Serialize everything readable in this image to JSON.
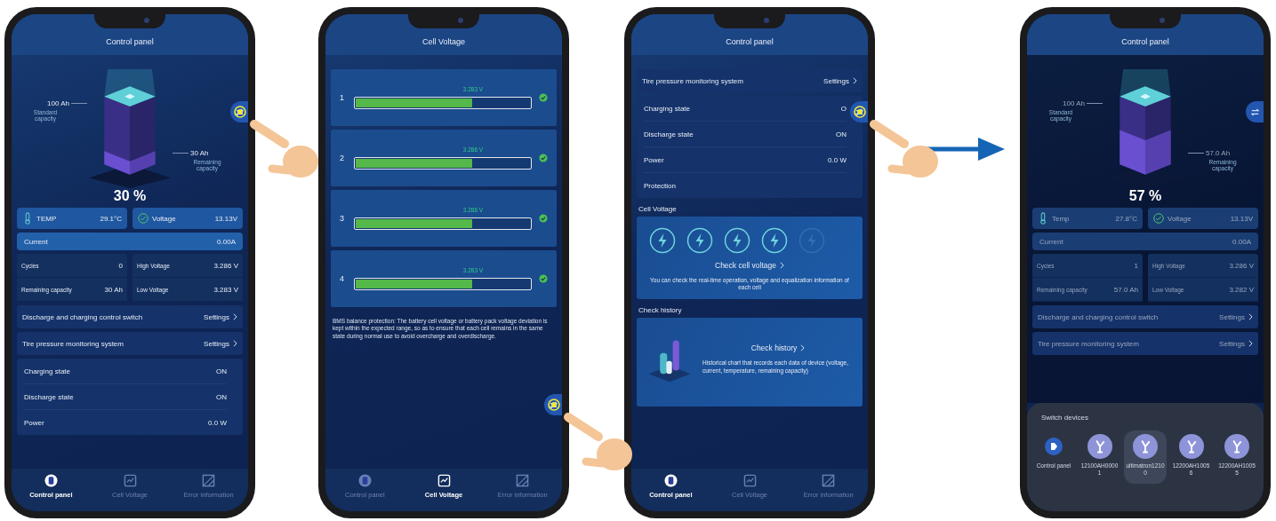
{
  "phones": [
    {
      "title": "Control panel",
      "tapped": true,
      "sections": [
        {
          "kind": "battery",
          "standard": "100 Ah",
          "standard_caption": "Standard capacity",
          "remaining": "30 Ah",
          "remaining_caption": "Remaining capacity",
          "percent": "30 %",
          "level": 0.3
        },
        {
          "kind": "tiles",
          "items": [
            {
              "label": "TEMP",
              "value": "29.1°C"
            },
            {
              "label": "Voltage",
              "value": "13.13V"
            }
          ]
        },
        {
          "kind": "bar",
          "label": "Current",
          "value": "0.00A"
        },
        {
          "kind": "stats",
          "columns": [
            {
              "rows": [
                {
                  "label": "Cycles",
                  "value": "0"
                },
                {
                  "label": "Remaining capacity",
                  "value": "30 Ah"
                }
              ]
            },
            {
              "rows": [
                {
                  "label": "High Voltage",
                  "value": "3.286 V"
                },
                {
                  "label": "Low Voltage",
                  "value": "3.283 V"
                }
              ]
            }
          ]
        },
        {
          "kind": "link",
          "label": "Discharge and charging control switch",
          "action": "Settings"
        },
        {
          "kind": "link",
          "label": "Tire pressure monitoring system",
          "action": "Settings"
        },
        {
          "kind": "states",
          "rows": [
            {
              "label": "Charging state",
              "value": "ON"
            },
            {
              "label": "Discharge state",
              "value": "ON"
            },
            {
              "label": "Power",
              "value": "0.0 W"
            }
          ]
        }
      ],
      "nav": [
        {
          "label": "Control panel",
          "selected": true
        },
        {
          "label": "Cell Voltage",
          "selected": false
        },
        {
          "label": "Error information",
          "selected": false
        }
      ]
    },
    {
      "title": "Cell Voltage",
      "tapped": true,
      "sections": [
        {
          "kind": "cell",
          "index": "1",
          "value": "3.283 V",
          "level": 0.67
        },
        {
          "kind": "cell",
          "index": "2",
          "value": "3.286 V",
          "level": 0.67
        },
        {
          "kind": "cell",
          "index": "3",
          "value": "3.286 V",
          "level": 0.67
        },
        {
          "kind": "cell",
          "index": "4",
          "value": "3.283 V",
          "level": 0.67
        },
        {
          "kind": "note",
          "text": "BMS balance protection: The battery cell voltage or battery pack voltage deviation is kept within the expected range, so as to ensure that each cell remains in the same state during normal use to avoid overcharge and overdischarge."
        }
      ],
      "nav": [
        {
          "label": "Control panel",
          "selected": false
        },
        {
          "label": "Cell Voltage",
          "selected": true
        },
        {
          "label": "Error information",
          "selected": false
        }
      ]
    },
    {
      "title": "Control panel",
      "tapped": true,
      "sections": [
        {
          "kind": "link",
          "label": "Tire pressure monitoring system",
          "action": "Settings"
        },
        {
          "kind": "states",
          "rows": [
            {
              "label": "Charging state",
              "value": "O"
            },
            {
              "label": "Discharge state",
              "value": "ON"
            },
            {
              "label": "Power",
              "value": "0.0 W"
            },
            {
              "label": "Protection"
            }
          ]
        },
        {
          "kind": "heading",
          "text": "Cell Voltage"
        },
        {
          "kind": "cell_card",
          "cells": [
            {
              "active": true
            },
            {
              "active": true
            },
            {
              "active": true
            },
            {
              "active": true
            },
            {
              "active": false
            }
          ],
          "action": "Check cell voltage",
          "text": "You can check the real-time operation, voltage and equalization information of each cell"
        },
        {
          "kind": "heading",
          "text": "Check history"
        },
        {
          "kind": "history_card",
          "action": "Check history",
          "text": "Historical chart that records each data of device (voltage, current, temperature, remaining capacity)"
        }
      ],
      "nav": [
        {
          "label": "Control panel",
          "selected": true
        },
        {
          "label": "Cell Voltage",
          "selected": false
        },
        {
          "label": "Error information",
          "selected": false
        }
      ]
    },
    {
      "title": "Control panel",
      "dimmed": true,
      "sections": [
        {
          "kind": "battery",
          "standard": "100 Ah",
          "standard_caption": "Standard capacity",
          "remaining": "57.0 Ah",
          "remaining_caption": "Remaining capacity",
          "percent": "57 %",
          "level": 0.57
        },
        {
          "kind": "tiles",
          "items": [
            {
              "label": "Temp",
              "value": "27.8°C"
            },
            {
              "label": "Voltage",
              "value": "13.13V"
            }
          ]
        },
        {
          "kind": "bar",
          "label": "Current",
          "value": "0.00A"
        },
        {
          "kind": "stats",
          "columns": [
            {
              "rows": [
                {
                  "label": "Cycles",
                  "value": "1"
                },
                {
                  "label": "Remaining capacity",
                  "value": "57.0 Ah"
                }
              ]
            },
            {
              "rows": [
                {
                  "label": "High Voltage",
                  "value": "3.286 V"
                },
                {
                  "label": "Low Voltage",
                  "value": "3.282 V"
                }
              ]
            }
          ]
        },
        {
          "kind": "link",
          "label": "Discharge and charging control switch",
          "action": "Settings"
        },
        {
          "kind": "link",
          "label": "Tire pressure monitoring system",
          "action": "Settings"
        }
      ],
      "sheet": {
        "title": "Switch devices",
        "devices": [
          {
            "kind": "panel",
            "label": "Control panel",
            "selected": false
          },
          {
            "kind": "device",
            "label": "12100AH00001",
            "selected": false
          },
          {
            "kind": "device",
            "label": "ultimatron12100",
            "selected": true
          },
          {
            "kind": "device",
            "label": "12200AH10056",
            "selected": false
          },
          {
            "kind": "device",
            "label": "12200AH10055",
            "selected": false
          }
        ]
      }
    }
  ]
}
